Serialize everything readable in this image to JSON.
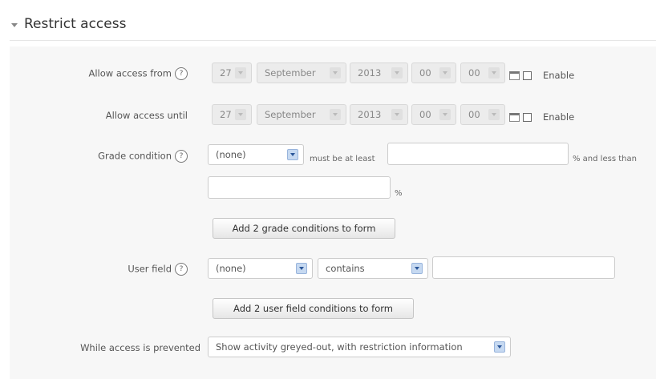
{
  "section": {
    "title": "Restrict access"
  },
  "access_from": {
    "label": "Allow access from",
    "day": "27",
    "month": "September",
    "year": "2013",
    "hour": "00",
    "minute": "00",
    "enable_label": "Enable"
  },
  "access_until": {
    "label": "Allow access until",
    "day": "27",
    "month": "September",
    "year": "2013",
    "hour": "00",
    "minute": "00",
    "enable_label": "Enable"
  },
  "grade_condition": {
    "label": "Grade condition",
    "selected": "(none)",
    "at_least_text": "must be at least",
    "less_than_text": "% and less than",
    "percent_text": "%",
    "add_button": "Add 2 grade conditions to form"
  },
  "user_field": {
    "label": "User field",
    "field_selected": "(none)",
    "operator_selected": "contains",
    "add_button": "Add 2 user field conditions to form"
  },
  "prevented": {
    "label": "While access is prevented",
    "selected": "Show activity greyed-out, with restriction information"
  },
  "help_glyph": "?",
  "icons": {
    "help": "help-icon",
    "calendar": "calendar-icon",
    "dropdown": "chevron-down-icon",
    "collapse": "collapse-triangle-icon"
  },
  "colors": {
    "panel_bg": "#f7f7f7",
    "dropdown_arrow": "#2a5699"
  }
}
